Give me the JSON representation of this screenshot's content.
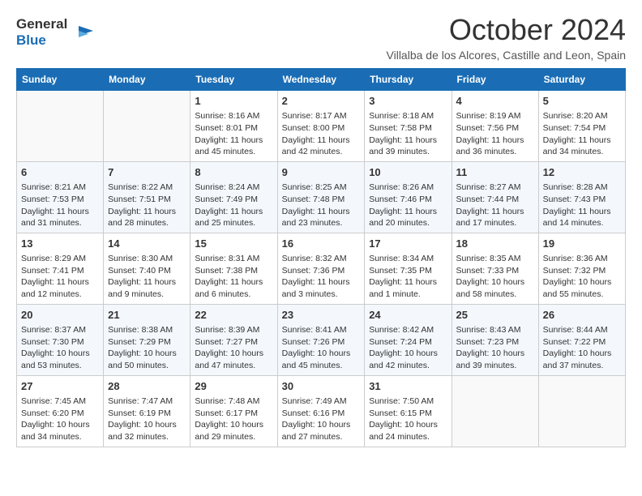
{
  "logo": {
    "line1": "General",
    "line2": "Blue"
  },
  "title": "October 2024",
  "subtitle": "Villalba de los Alcores, Castille and Leon, Spain",
  "headers": [
    "Sunday",
    "Monday",
    "Tuesday",
    "Wednesday",
    "Thursday",
    "Friday",
    "Saturday"
  ],
  "weeks": [
    [
      {
        "day": "",
        "info": ""
      },
      {
        "day": "",
        "info": ""
      },
      {
        "day": "1",
        "info": "Sunrise: 8:16 AM\nSunset: 8:01 PM\nDaylight: 11 hours and 45 minutes."
      },
      {
        "day": "2",
        "info": "Sunrise: 8:17 AM\nSunset: 8:00 PM\nDaylight: 11 hours and 42 minutes."
      },
      {
        "day": "3",
        "info": "Sunrise: 8:18 AM\nSunset: 7:58 PM\nDaylight: 11 hours and 39 minutes."
      },
      {
        "day": "4",
        "info": "Sunrise: 8:19 AM\nSunset: 7:56 PM\nDaylight: 11 hours and 36 minutes."
      },
      {
        "day": "5",
        "info": "Sunrise: 8:20 AM\nSunset: 7:54 PM\nDaylight: 11 hours and 34 minutes."
      }
    ],
    [
      {
        "day": "6",
        "info": "Sunrise: 8:21 AM\nSunset: 7:53 PM\nDaylight: 11 hours and 31 minutes."
      },
      {
        "day": "7",
        "info": "Sunrise: 8:22 AM\nSunset: 7:51 PM\nDaylight: 11 hours and 28 minutes."
      },
      {
        "day": "8",
        "info": "Sunrise: 8:24 AM\nSunset: 7:49 PM\nDaylight: 11 hours and 25 minutes."
      },
      {
        "day": "9",
        "info": "Sunrise: 8:25 AM\nSunset: 7:48 PM\nDaylight: 11 hours and 23 minutes."
      },
      {
        "day": "10",
        "info": "Sunrise: 8:26 AM\nSunset: 7:46 PM\nDaylight: 11 hours and 20 minutes."
      },
      {
        "day": "11",
        "info": "Sunrise: 8:27 AM\nSunset: 7:44 PM\nDaylight: 11 hours and 17 minutes."
      },
      {
        "day": "12",
        "info": "Sunrise: 8:28 AM\nSunset: 7:43 PM\nDaylight: 11 hours and 14 minutes."
      }
    ],
    [
      {
        "day": "13",
        "info": "Sunrise: 8:29 AM\nSunset: 7:41 PM\nDaylight: 11 hours and 12 minutes."
      },
      {
        "day": "14",
        "info": "Sunrise: 8:30 AM\nSunset: 7:40 PM\nDaylight: 11 hours and 9 minutes."
      },
      {
        "day": "15",
        "info": "Sunrise: 8:31 AM\nSunset: 7:38 PM\nDaylight: 11 hours and 6 minutes."
      },
      {
        "day": "16",
        "info": "Sunrise: 8:32 AM\nSunset: 7:36 PM\nDaylight: 11 hours and 3 minutes."
      },
      {
        "day": "17",
        "info": "Sunrise: 8:34 AM\nSunset: 7:35 PM\nDaylight: 11 hours and 1 minute."
      },
      {
        "day": "18",
        "info": "Sunrise: 8:35 AM\nSunset: 7:33 PM\nDaylight: 10 hours and 58 minutes."
      },
      {
        "day": "19",
        "info": "Sunrise: 8:36 AM\nSunset: 7:32 PM\nDaylight: 10 hours and 55 minutes."
      }
    ],
    [
      {
        "day": "20",
        "info": "Sunrise: 8:37 AM\nSunset: 7:30 PM\nDaylight: 10 hours and 53 minutes."
      },
      {
        "day": "21",
        "info": "Sunrise: 8:38 AM\nSunset: 7:29 PM\nDaylight: 10 hours and 50 minutes."
      },
      {
        "day": "22",
        "info": "Sunrise: 8:39 AM\nSunset: 7:27 PM\nDaylight: 10 hours and 47 minutes."
      },
      {
        "day": "23",
        "info": "Sunrise: 8:41 AM\nSunset: 7:26 PM\nDaylight: 10 hours and 45 minutes."
      },
      {
        "day": "24",
        "info": "Sunrise: 8:42 AM\nSunset: 7:24 PM\nDaylight: 10 hours and 42 minutes."
      },
      {
        "day": "25",
        "info": "Sunrise: 8:43 AM\nSunset: 7:23 PM\nDaylight: 10 hours and 39 minutes."
      },
      {
        "day": "26",
        "info": "Sunrise: 8:44 AM\nSunset: 7:22 PM\nDaylight: 10 hours and 37 minutes."
      }
    ],
    [
      {
        "day": "27",
        "info": "Sunrise: 7:45 AM\nSunset: 6:20 PM\nDaylight: 10 hours and 34 minutes."
      },
      {
        "day": "28",
        "info": "Sunrise: 7:47 AM\nSunset: 6:19 PM\nDaylight: 10 hours and 32 minutes."
      },
      {
        "day": "29",
        "info": "Sunrise: 7:48 AM\nSunset: 6:17 PM\nDaylight: 10 hours and 29 minutes."
      },
      {
        "day": "30",
        "info": "Sunrise: 7:49 AM\nSunset: 6:16 PM\nDaylight: 10 hours and 27 minutes."
      },
      {
        "day": "31",
        "info": "Sunrise: 7:50 AM\nSunset: 6:15 PM\nDaylight: 10 hours and 24 minutes."
      },
      {
        "day": "",
        "info": ""
      },
      {
        "day": "",
        "info": ""
      }
    ]
  ]
}
